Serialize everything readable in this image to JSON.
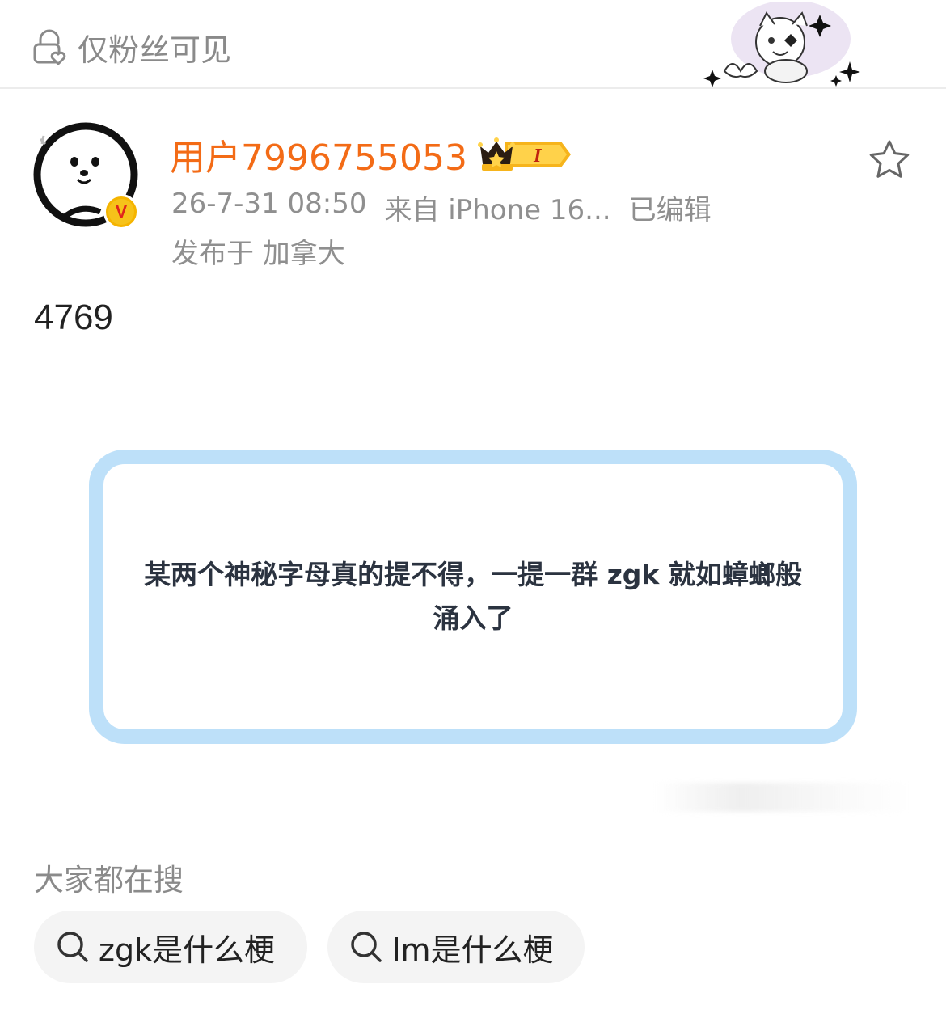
{
  "header": {
    "visibility_label": "仅粉丝可见",
    "icons": [
      "lock-heart-icon",
      "decorative-cat-sticker"
    ]
  },
  "author": {
    "name": "用户7996755053",
    "verified_badge": "V",
    "vip_badge": "I",
    "timestamp": "26-7-31 08:50",
    "source": "来自 iPhone 16...",
    "edited": "已编辑",
    "location": "发布于 加拿大"
  },
  "post": {
    "text": "4769",
    "quote": "某两个神秘字母真的提不得，一提一群 zgk 就如蟑螂般涌入了"
  },
  "searches": {
    "heading": "大家都在搜",
    "items": [
      {
        "label": "zgk是什么梗"
      },
      {
        "label": "lm是什么梗"
      }
    ]
  },
  "colors": {
    "username": "#f36b16",
    "muted": "#8f8f8f",
    "card_border": "#bde0f9",
    "chip_bg": "#f4f4f4"
  }
}
